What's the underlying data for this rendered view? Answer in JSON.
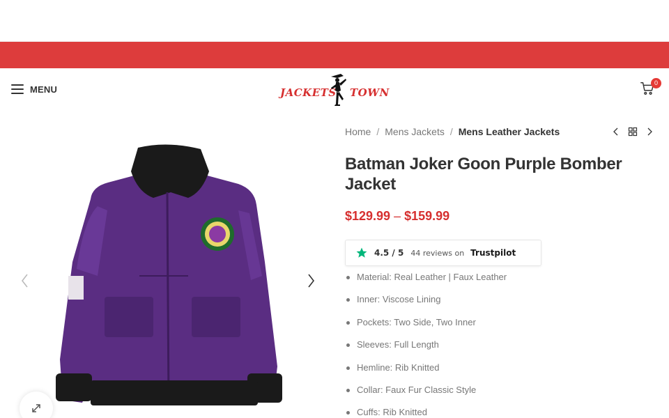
{
  "header": {
    "menu_label": "MENU",
    "logo": {
      "left_text": "JACKETS",
      "right_text": "TOWN"
    },
    "cart_count": "0"
  },
  "colors": {
    "promo_bar": "#dd3c3c",
    "accent": "#d62f2f",
    "trustpilot_green": "#00b67a"
  },
  "icons": [
    "hamburger-icon",
    "cart-icon",
    "chevron-left-icon",
    "chevron-right-icon",
    "grid-icon",
    "expand-icon",
    "star-icon"
  ],
  "breadcrumb": {
    "items": [
      "Home",
      "Mens Jackets"
    ],
    "separator": "/",
    "current": "Mens Leather Jackets"
  },
  "product": {
    "title": "Batman Joker Goon Purple Bomber Jacket",
    "price_min": "$129.99",
    "price_sep": "–",
    "price_max": "$159.99"
  },
  "trustpilot": {
    "rating": "4.5 / 5",
    "reviews": "44 reviews on",
    "brand": "Trustpilot"
  },
  "features": [
    "Material: Real Leather | Faux Leather",
    "Inner: Viscose Lining",
    "Pockets: Two Side, Two Inner",
    "Sleeves: Full Length",
    "Hemline: Rib Knitted",
    "Collar: Faux Fur Classic Style",
    "Cuffs: Rib Knitted"
  ]
}
